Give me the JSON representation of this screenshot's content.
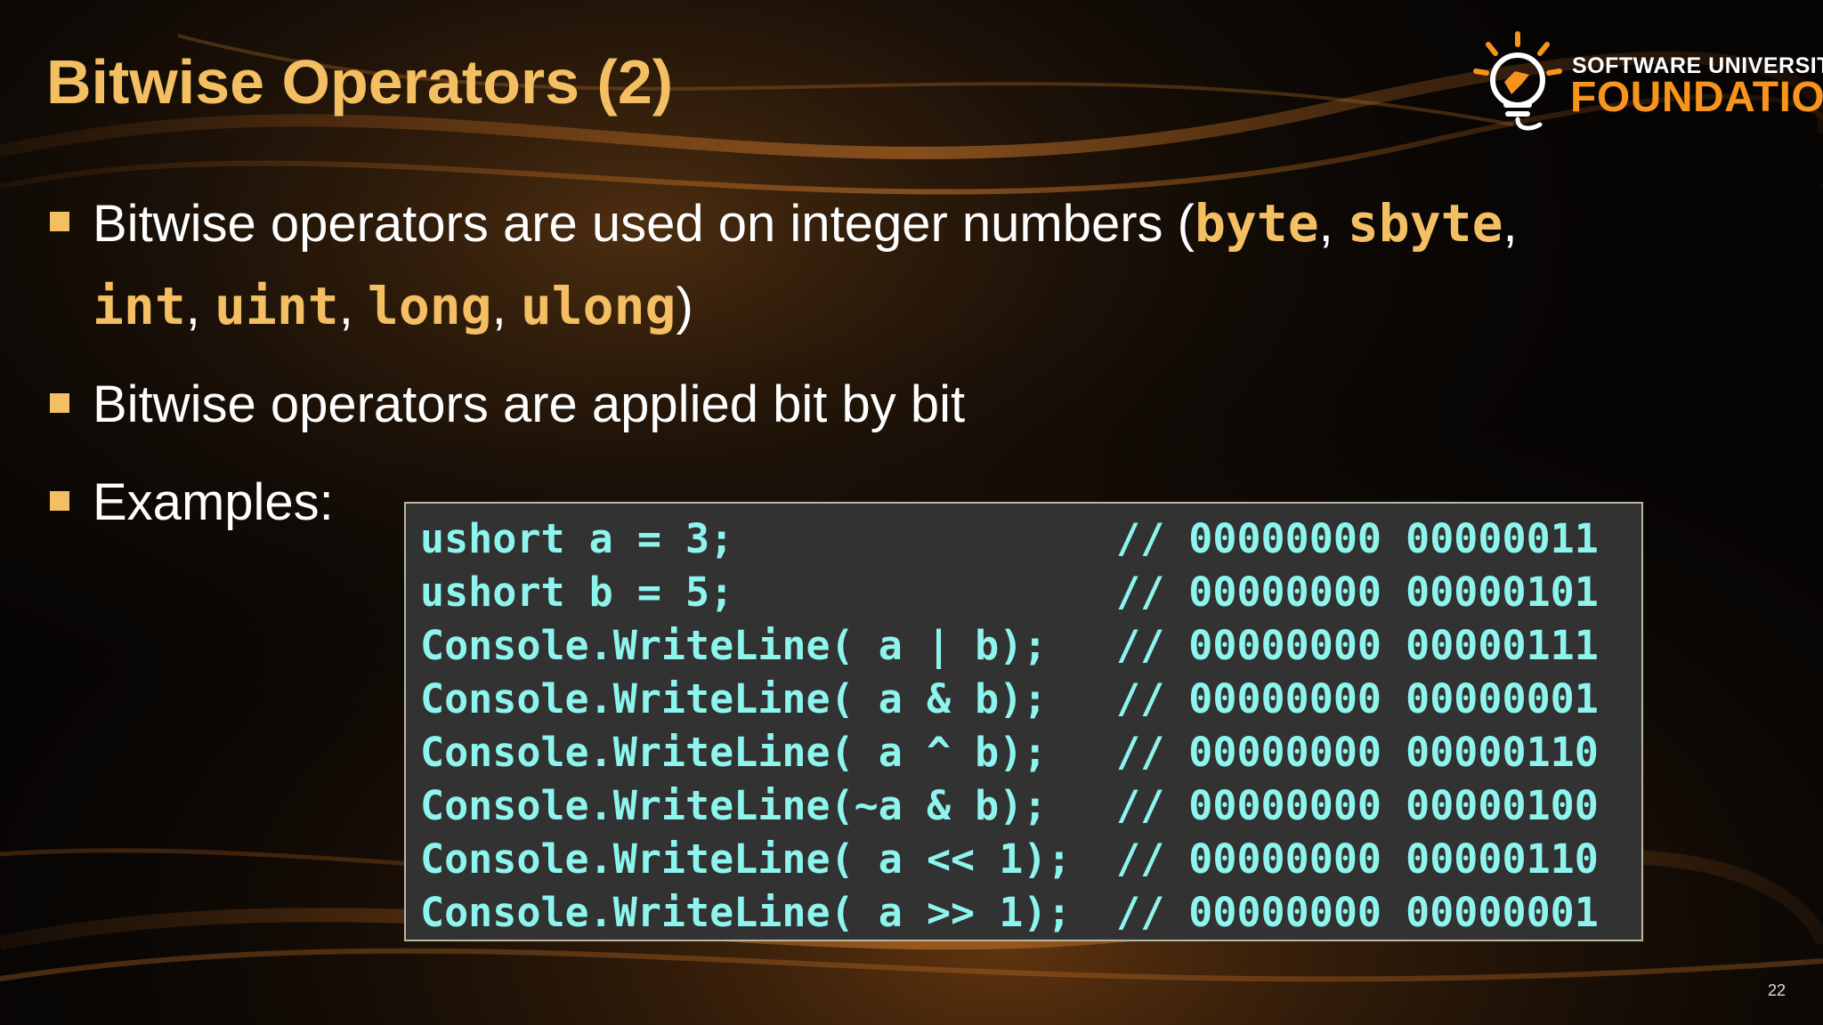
{
  "slide": {
    "title": "Bitwise Operators (2)",
    "page_number": "22"
  },
  "logo": {
    "line1": "SOFTWARE UNIVERSITY",
    "line2": "FOUNDATION",
    "icon": "lightbulb-icon"
  },
  "bullets": {
    "b1": {
      "text_start": "Bitwise operators are used on integer numbers (",
      "kw1": "byte",
      "sep1": ", ",
      "kw2": "sbyte",
      "sep2": ",",
      "kw3": "int",
      "sep3": ", ",
      "kw4": "uint",
      "sep4": ", ",
      "kw5": "long",
      "sep5": ", ",
      "kw6": "ulong",
      "text_end": ")"
    },
    "b2": {
      "text": "Bitwise operators are applied bit by bit"
    },
    "b3": {
      "text": "Examples:"
    }
  },
  "code": {
    "lines": [
      {
        "stmt": "ushort a = 3;",
        "comment": "// 00000000 00000011"
      },
      {
        "stmt": "ushort b = 5;",
        "comment": "// 00000000 00000101"
      },
      {
        "stmt": "Console.WriteLine( a | b);",
        "comment": "// 00000000 00000111"
      },
      {
        "stmt": "Console.WriteLine( a & b);",
        "comment": "// 00000000 00000001"
      },
      {
        "stmt": "Console.WriteLine( a ^ b);",
        "comment": "// 00000000 00000110"
      },
      {
        "stmt": "Console.WriteLine(~a & b);",
        "comment": "// 00000000 00000100"
      },
      {
        "stmt": "Console.WriteLine( a << 1);",
        "comment": "// 00000000 00000110"
      },
      {
        "stmt": "Console.WriteLine( a >> 1);",
        "comment": "// 00000000 00000001"
      }
    ]
  },
  "colors": {
    "title": "#f4bf62",
    "keyword": "#f4bf62",
    "code_text": "#8df5ee",
    "code_bg": "#323232",
    "logo_accent": "#f7941d"
  }
}
